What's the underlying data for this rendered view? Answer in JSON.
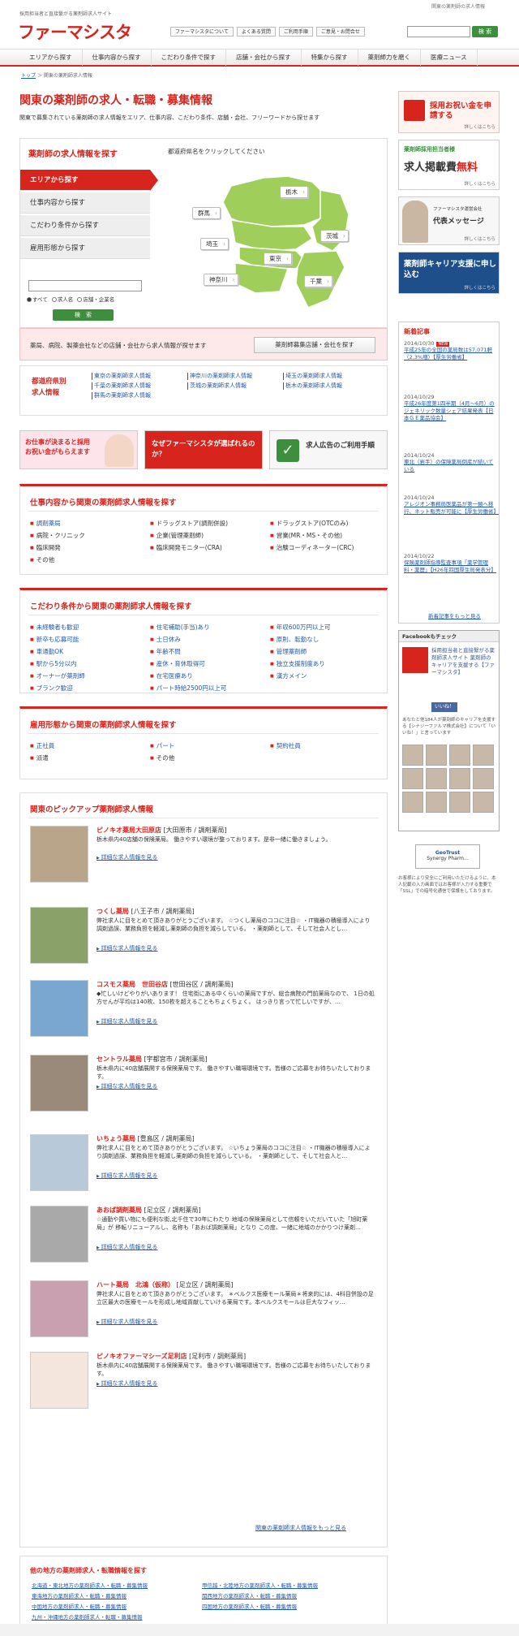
{
  "header": {
    "tagline": "採用担当者と直接繋がる薬剤師求人サイト",
    "tagright": "関東の薬剤師の求人情報",
    "logo": "ファーマシスタ",
    "links": [
      "ファーマシスタについて",
      "よくある質問",
      "ご利用手順",
      "ご意見・お問合せ"
    ],
    "search_button": "検 索"
  },
  "nav": [
    "エリアから探す",
    "仕事内容から探す",
    "こだわり条件で探す",
    "店舗・会社から探す",
    "特集から探す",
    "薬剤師力を磨く",
    "医療ニュース"
  ],
  "breadcrumb": {
    "home": "トップ",
    "sep": "＞",
    "current": "関東の薬剤師求人情報"
  },
  "title": "関東の薬剤師の求人・転職・募集情報",
  "lead": "関東で募集されている薬剤師の求人情報をエリア、仕事内容、こだわり条件、店舗・会社、フリーワードから探せます",
  "search": {
    "title": "薬剤師の求人情報を探す",
    "hint": "都道府県名をクリックしてください",
    "menu": [
      "エリアから探す",
      "仕事内容から探す",
      "こだわり条件から探す",
      "雇用形態から探す"
    ],
    "radios": [
      "すべて",
      "求人名",
      "店舗・企業名"
    ],
    "button": "検　索"
  },
  "map": {
    "prefs": [
      "栃木",
      "群馬",
      "茨城",
      "埼玉",
      "東京",
      "神奈川",
      "千葉"
    ],
    "color": "#9fcf5a"
  },
  "recruit": {
    "text": "薬局、病院、製薬会社などの店舗・会社から求人情報が探せます",
    "button": "薬剤師募集店舗・会社を探す"
  },
  "pref": {
    "head1": "都道府県別",
    "head2": "求人情報",
    "links": [
      "東京の薬剤師求人情報",
      "神奈川の薬剤師求人情報",
      "埼玉の薬剤師求人情報",
      "千葉の薬剤師求人情報",
      "茨城の薬剤師求人情報",
      "栃木の薬剤師求人情報",
      "群馬の薬剤師求人情報"
    ]
  },
  "banners": [
    "お仕事が決まると採用お祝い金がもらえます",
    "なぜファーマシスタが選ばれるのか？",
    "求人広告のご利用手順"
  ],
  "job": {
    "title": "仕事内容から関東の薬剤師求人情報を探す",
    "items": [
      {
        "t": "調剤薬局",
        "l": true
      },
      {
        "t": "ドラッグストア(調剤併設)",
        "l": false
      },
      {
        "t": "ドラッグストア(OTCのみ)",
        "l": false
      },
      {
        "t": "病院・クリニック",
        "l": false
      },
      {
        "t": "企業(管理薬剤師)",
        "l": false
      },
      {
        "t": "営業(MR・MS・その他)",
        "l": false
      },
      {
        "t": "臨床開発",
        "l": false
      },
      {
        "t": "臨床開発モニター(CRA)",
        "l": false
      },
      {
        "t": "治験コーディネーター(CRC)",
        "l": false
      },
      {
        "t": "その他",
        "l": false
      }
    ]
  },
  "cond": {
    "title": "こだわり条件から関東の薬剤師求人情報を探す",
    "items": [
      {
        "t": "未経験者も歓迎",
        "l": true
      },
      {
        "t": "住宅補助(手当)あり",
        "l": true
      },
      {
        "t": "年収600万円以上可",
        "l": true
      },
      {
        "t": "新卒も応募可能",
        "l": true
      },
      {
        "t": "土日休み",
        "l": true
      },
      {
        "t": "原則、転勤なし",
        "l": true
      },
      {
        "t": "車通勤OK",
        "l": true
      },
      {
        "t": "年齢不問",
        "l": true
      },
      {
        "t": "管理薬剤師",
        "l": true
      },
      {
        "t": "駅から5分以内",
        "l": true
      },
      {
        "t": "産休・育休取得可",
        "l": true
      },
      {
        "t": "独立支援制度あり",
        "l": true
      },
      {
        "t": "オーナーが薬剤師",
        "l": true
      },
      {
        "t": "在宅医療あり",
        "l": true
      },
      {
        "t": "漢方メイン",
        "l": true
      },
      {
        "t": "ブランク歓迎",
        "l": true
      },
      {
        "t": "パート時給2500円以上可",
        "l": true
      }
    ]
  },
  "emp": {
    "title": "雇用形態から関東の薬剤師求人情報を探す",
    "items": [
      {
        "t": "正社員",
        "l": true
      },
      {
        "t": "パート",
        "l": true
      },
      {
        "t": "契約社員",
        "l": true
      },
      {
        "t": "派遣",
        "l": false
      },
      {
        "t": "その他",
        "l": false
      }
    ]
  },
  "pickup": {
    "title": "関東のピックアップ薬剤師求人情報",
    "more_label": "詳細な求人情報を見る",
    "all": "関東の薬剤師求人情報をもっと見る",
    "items": [
      {
        "name": "ピノキオ薬局大田原店",
        "meta": "[大田原市 / 調剤薬局]",
        "desc": "栃木県内40店舗の保険薬局。 働きやすい環境が整っております。是非一緒に働きましょう。"
      },
      {
        "name": "つくし薬局",
        "meta": "[八王子市 / 調剤薬局]",
        "desc": "弊社求人に目をとめて頂きありがとうございます。 ☆つくし薬局のココに注目☆ ・IT機器の積極導入により調剤過誤、業務負担を軽減し薬剤師の負担を減らしている。 ・薬剤師として、そして社会人とし…"
      },
      {
        "name": "コスモス薬局　世田谷店",
        "meta": "[世田谷区 / 調剤薬局]",
        "desc": "◆忙しいけどやりがいあります！ 住宅街にある中くらいの薬局ですが、総合病院の門前薬局なので、 1日の処方せんが平均は140枚、150枚を超えることもちょくちょく。 はっきり言って忙しいですが、…"
      },
      {
        "name": "セントラル薬局",
        "meta": "[宇都宮市 / 調剤薬局]",
        "desc": "栃木県内に40店舗展開する保険薬局です。 働きやすい職場環境です。皆様のご応募をお待ちいたしております。"
      },
      {
        "name": "いちょう薬局",
        "meta": "[豊島区 / 調剤薬局]",
        "desc": "弊社求人に目をとめて頂きありがとうございます。 ☆いちょう薬局のココに注目☆ ・IT機器の積極導入により調剤過誤、業務負担を軽減し薬剤師の負担を減らしている。 ・薬剤師として、そして社会人と…"
      },
      {
        "name": "あおば調剤薬局",
        "meta": "[足立区 / 調剤薬局]",
        "desc": "☆通勤や買い物にも便利な街,北千住で30年にわたり 地域の保険薬局として信頼をいただいていた「旭町薬局」が 移転リニューアルし、名称も「あおば調剤薬局」となり この度、一緒に地域のかかりつけ薬剤…"
      },
      {
        "name": "ハート薬局　北鴻（仮称）",
        "meta": "[足立区 / 調剤薬局]",
        "desc": "弊社求人に目をとめて頂きありがとうございます。 ＊ベルクス医療モール薬局＊将来的には、4科目併設の足立区最大の医療モールを形成し地域貢献していける薬局です。本ベルクスモールは巨大なフィッ…"
      },
      {
        "name": "ピノキオファーマシーズ足利店",
        "meta": "[足利市 / 調剤薬局]",
        "desc": "栃木県内に40店舗展開する保険薬局です。 働きやすい職場環境です。皆様のご応募をお待ちいたしております。"
      }
    ]
  },
  "other": {
    "title": "他の地方の薬剤師求人・転職情報を探す",
    "links": [
      "北海道・東北地方の薬剤師求人・転職・募集情報",
      "甲信越・北陸地方の薬剤師求人・転職・募集情報",
      "東海地方の薬剤師求人・転職・募集情報",
      "関西地方の薬剤師求人・転職・募集情報",
      "中国地方の薬剤師求人・転職・募集情報",
      "四国地方の薬剤師求人・転職・募集情報",
      "九州・沖縄地方の薬剤師求人・転職・募集情報"
    ]
  },
  "side": {
    "b1": "採用お祝い金を申請する",
    "b1d": "詳しくはこちら",
    "b2a": "薬剤師採用担当者様",
    "b2b": "求人掲載費",
    "b2c": "無料",
    "b2d": "詳しくはこちら",
    "b3a": "ファーマシスタ運営会社",
    "b3b": "代表メッセージ",
    "b3d": "詳しくはこちら",
    "b4a": "薬剤師キャリア支援に申し込む",
    "b4d": "詳しくはこちら"
  },
  "news": {
    "title": "新着記事",
    "new": "NEW",
    "more": "新着記事をもっと見る",
    "items": [
      {
        "d": "2014/10/30",
        "t": "平成25年の全国の薬局数は57,071軒（2.3%増）【厚生労働省】"
      },
      {
        "d": "2014/10/29",
        "t": "平成26年度第1四半期（4月〜6月）のジェネリック数量シェア結果発表【日本ＧＥ薬品協会】"
      },
      {
        "d": "2014/10/24",
        "t": "東北（岩手）の保険薬局倒産が続いている"
      },
      {
        "d": "2014/10/24",
        "t": "アレジオン事務局医薬品が第一類へ移行、ネット販売が可能に【厚生労働省】"
      },
      {
        "d": "2014/10/22",
        "t": "保険薬剤師指導監査事項「薬学管理料・薬歴」【H26年四国厚生局発表分】"
      }
    ]
  },
  "fb": {
    "title": "Facebookもチェック",
    "page": "採用担当者と直接繋がる薬剤師求人サイト 薬剤師のキャリアを支援する【ファーマシスタ】",
    "like": "いいね！",
    "note": "あなたと他184人が薬剤師のキャリアを支援する【シナジーファルマ株式会社】について「いいね！」と言っています"
  },
  "geo": {
    "line1": "GeoTrust",
    "line2": "Synergy Pharm..."
  },
  "ssl": "お客様により安全にご利用いただけるように、本人記載の入力画面ではお客様が入力する重要で「SSL」での暗号化通信で保護をしております。"
}
